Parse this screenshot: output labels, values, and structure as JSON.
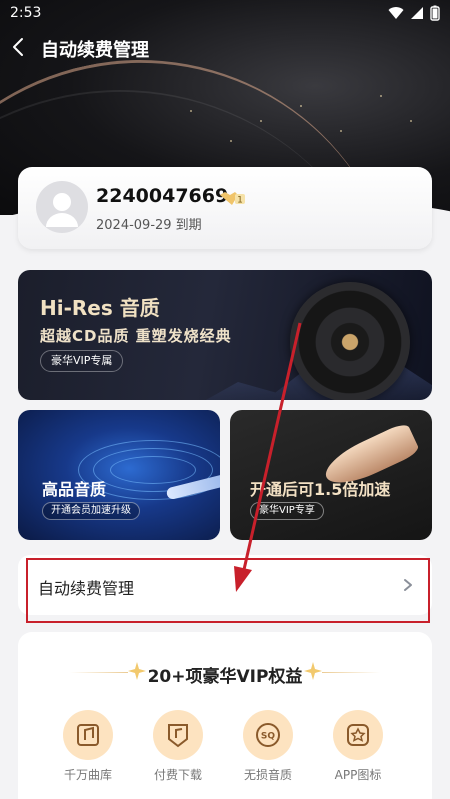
{
  "status_bar": {
    "time": "2:53"
  },
  "nav": {
    "title": "自动续费管理"
  },
  "user": {
    "id": "2240047669",
    "vip_level": "1",
    "expire": "2024-09-29 到期"
  },
  "banner_hires": {
    "title": "Hi-Res 音质",
    "subtitle": "超越CD品质  重塑发烧经典",
    "pill": "豪华VIP专属"
  },
  "banner_quality": {
    "title": "高品音质",
    "pill": "开通会员加速升级"
  },
  "banner_speed": {
    "title": "开通后可1.5倍加速",
    "pill": "豪华VIP专享"
  },
  "renew_row": {
    "label": "自动续费管理"
  },
  "benefits": {
    "title": "20+项豪华VIP权益",
    "items": [
      {
        "label": "千万曲库",
        "icon": "music-library-icon"
      },
      {
        "label": "付费下载",
        "icon": "download-music-icon"
      },
      {
        "label": "无损音质",
        "icon": "sq-icon"
      },
      {
        "label": "APP图标",
        "icon": "app-icon"
      }
    ]
  },
  "colors": {
    "accent_gold": "#f1e1c2",
    "highlight_red": "#c8202b",
    "benefit_bg": "#fde3c0"
  }
}
